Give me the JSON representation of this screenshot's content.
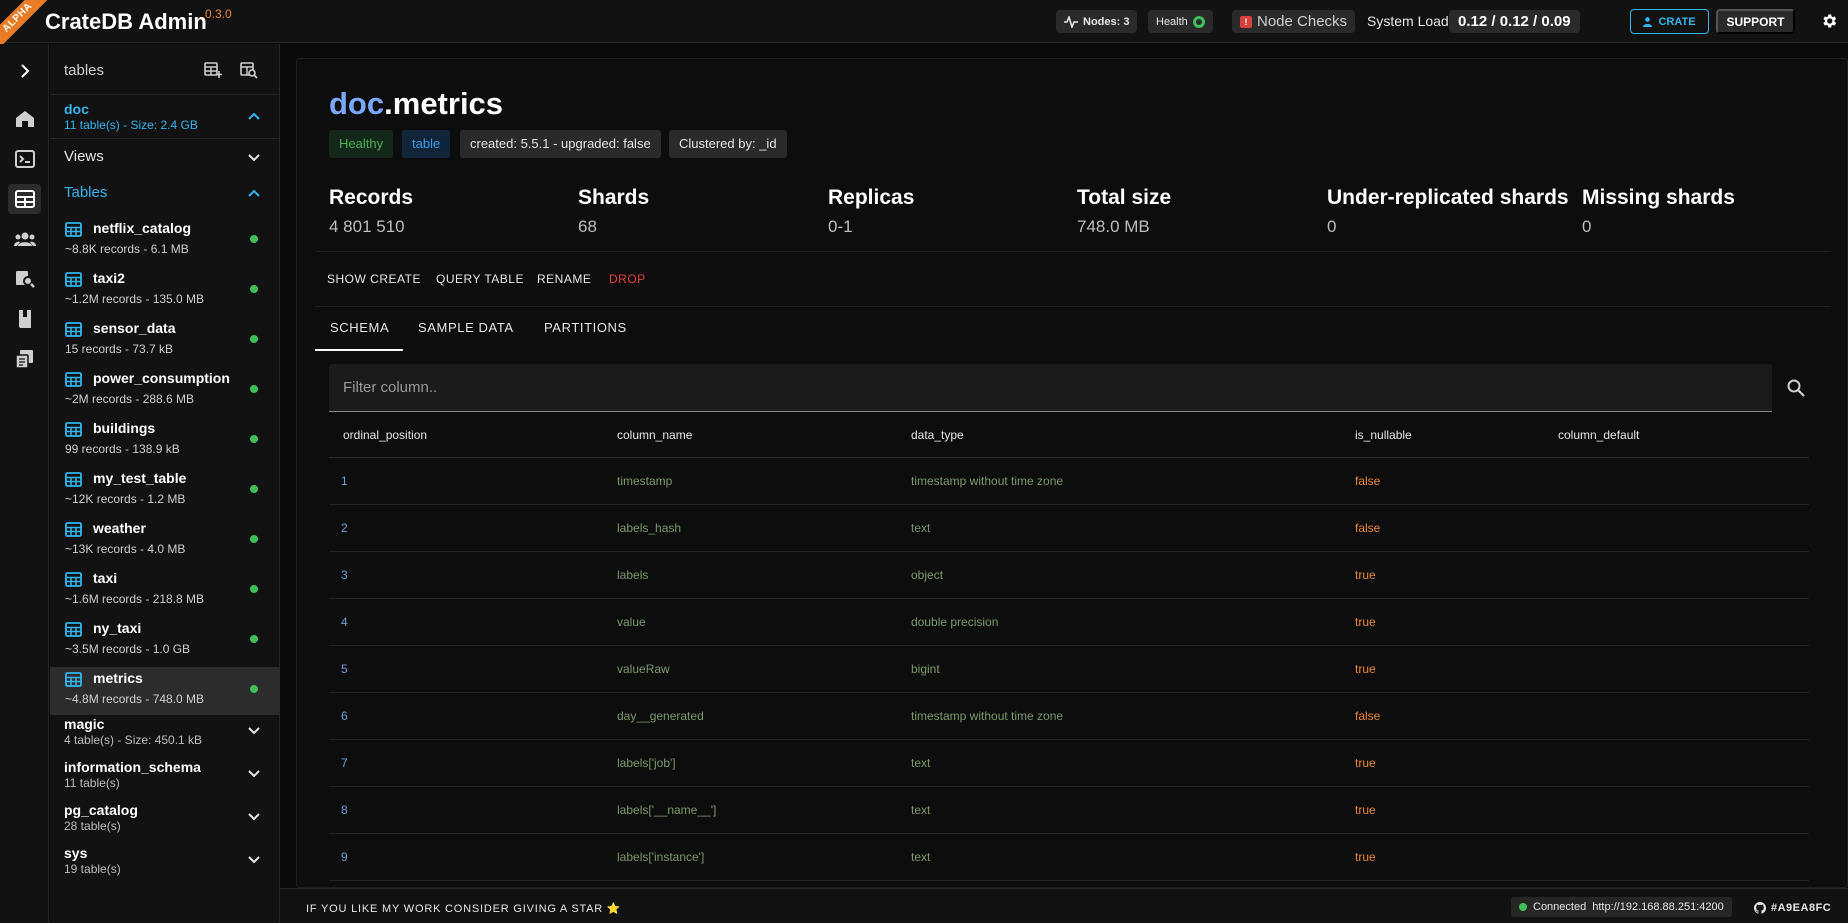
{
  "app": {
    "alpha": "ALPHA",
    "title": "CrateDB Admin",
    "version": "0.3.0"
  },
  "topbar": {
    "nodes": "Nodes: 3",
    "health": "Health",
    "node_checks": "Node Checks",
    "node_checks_badge": "!",
    "system_load_label": "System Load",
    "system_load_value": "0.12 / 0.12 / 0.09",
    "crate_button": "CRATE",
    "support_button": "SUPPORT"
  },
  "rail": {
    "icons": [
      "overview-icon",
      "console-icon",
      "tables-icon",
      "users-icon",
      "query-search-icon",
      "docs-icon",
      "cluster-icon"
    ],
    "active": "tables-icon"
  },
  "sidebar": {
    "heading": "tables",
    "schemas": {
      "doc": {
        "name": "doc",
        "summary": "11 table(s) - Size: 2.4 GB"
      },
      "magic": {
        "name": "magic",
        "summary": "4 table(s) - Size: 450.1 kB"
      },
      "information_schema": {
        "name": "information_schema",
        "summary": "11 table(s)"
      },
      "pg_catalog": {
        "name": "pg_catalog",
        "summary": "28 table(s)"
      },
      "sys": {
        "name": "sys",
        "summary": "19 table(s)"
      }
    },
    "views_label": "Views",
    "tables_label": "Tables",
    "tables": [
      {
        "name": "netflix_catalog",
        "info": "~8.8K records - 6.1 MB"
      },
      {
        "name": "taxi2",
        "info": "~1.2M records - 135.0 MB"
      },
      {
        "name": "sensor_data",
        "info": "15 records - 73.7 kB"
      },
      {
        "name": "power_consumption",
        "info": "~2M records - 288.6 MB"
      },
      {
        "name": "buildings",
        "info": "99 records - 138.9 kB"
      },
      {
        "name": "my_test_table",
        "info": "~12K records - 1.2 MB"
      },
      {
        "name": "weather",
        "info": "~13K records - 4.0 MB"
      },
      {
        "name": "taxi",
        "info": "~1.6M records - 218.8 MB"
      },
      {
        "name": "ny_taxi",
        "info": "~3.5M records - 1.0 GB"
      },
      {
        "name": "metrics",
        "info": "~4.8M records - 748.0 MB"
      }
    ],
    "selected_table": "metrics"
  },
  "main": {
    "title_schema": "doc",
    "title_dot": ".",
    "title_table": "metrics",
    "badges": {
      "health": "Healthy",
      "type": "table",
      "created": "created: 5.5.1 - upgraded: false",
      "clustered": "Clustered by: _id"
    },
    "stats": [
      {
        "label": "Records",
        "value": "4 801 510"
      },
      {
        "label": "Shards",
        "value": "68"
      },
      {
        "label": "Replicas",
        "value": "0-1"
      },
      {
        "label": "Total size",
        "value": "748.0 MB"
      },
      {
        "label": "Under-replicated shards",
        "value": "0"
      },
      {
        "label": "Missing shards",
        "value": "0"
      }
    ],
    "actions": {
      "show_create": "SHOW CREATE",
      "query_table": "QUERY TABLE",
      "rename": "RENAME",
      "drop": "DROP"
    },
    "tabs": {
      "schema": "SCHEMA",
      "sample_data": "SAMPLE DATA",
      "partitions": "PARTITIONS"
    },
    "active_tab": "SCHEMA",
    "filter_placeholder": "Filter column..",
    "columns": [
      "ordinal_position",
      "column_name",
      "data_type",
      "is_nullable",
      "column_default"
    ],
    "rows": [
      {
        "pos": "1",
        "name": "timestamp",
        "type": "timestamp without time zone",
        "nullable": "false",
        "default": ""
      },
      {
        "pos": "2",
        "name": "labels_hash",
        "type": "text",
        "nullable": "false",
        "default": ""
      },
      {
        "pos": "3",
        "name": "labels",
        "type": "object",
        "nullable": "true",
        "default": ""
      },
      {
        "pos": "4",
        "name": "value",
        "type": "double precision",
        "nullable": "true",
        "default": ""
      },
      {
        "pos": "5",
        "name": "valueRaw",
        "type": "bigint",
        "nullable": "true",
        "default": ""
      },
      {
        "pos": "6",
        "name": "day__generated",
        "type": "timestamp without time zone",
        "nullable": "false",
        "default": ""
      },
      {
        "pos": "7",
        "name": "labels['job']",
        "type": "text",
        "nullable": "true",
        "default": ""
      },
      {
        "pos": "8",
        "name": "labels['__name__']",
        "type": "text",
        "nullable": "true",
        "default": ""
      },
      {
        "pos": "9",
        "name": "labels['instance']",
        "type": "text",
        "nullable": "true",
        "default": ""
      }
    ]
  },
  "footer": {
    "message": "IF YOU LIKE MY WORK CONSIDER GIVING A STAR",
    "star": "⭐",
    "connected_label": "Connected",
    "connected_url": "http://192.168.88.251:4200",
    "commit": "#A9EA8FC"
  },
  "colors": {
    "accent": "#33b6f0",
    "healthy": "#3fbf5a",
    "drop": "#e4453b",
    "nullable": "#e9893a",
    "schema_title": "#7aa7ff"
  }
}
